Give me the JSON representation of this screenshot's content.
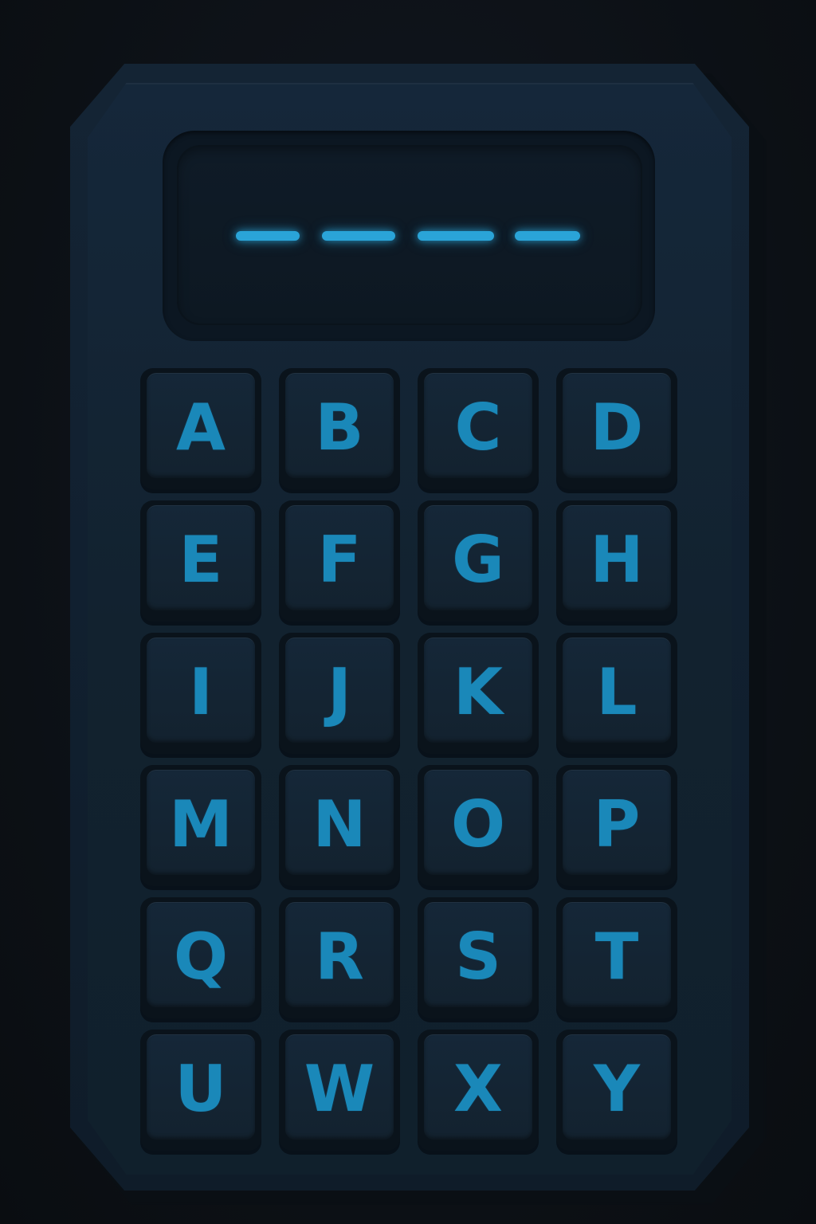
{
  "display": {
    "slots": [
      "",
      "",
      "",
      ""
    ]
  },
  "keypad": {
    "keys": [
      {
        "label": "A"
      },
      {
        "label": "B"
      },
      {
        "label": "C"
      },
      {
        "label": "D"
      },
      {
        "label": "E"
      },
      {
        "label": "F"
      },
      {
        "label": "G"
      },
      {
        "label": "H"
      },
      {
        "label": "I"
      },
      {
        "label": "J"
      },
      {
        "label": "K"
      },
      {
        "label": "L"
      },
      {
        "label": "M"
      },
      {
        "label": "N"
      },
      {
        "label": "O"
      },
      {
        "label": "P"
      },
      {
        "label": "Q"
      },
      {
        "label": "R"
      },
      {
        "label": "S"
      },
      {
        "label": "T"
      },
      {
        "label": "U"
      },
      {
        "label": "W"
      },
      {
        "label": "X"
      },
      {
        "label": "Y"
      }
    ]
  },
  "colors": {
    "accent": "#2aa4d8",
    "key_text": "#1a88b9",
    "body": "#12222f",
    "background": "#0d1116"
  }
}
